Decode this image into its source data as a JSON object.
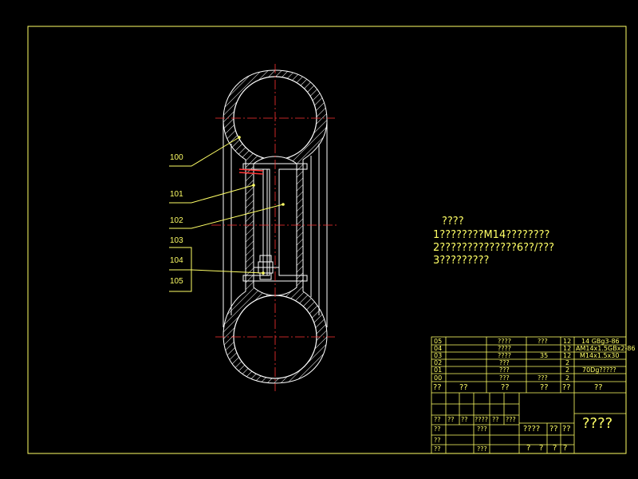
{
  "part_labels": [
    "100",
    "101",
    "102",
    "103",
    "104",
    "105"
  ],
  "notes": {
    "heading": "????",
    "line1": "1????????M14????????",
    "line2": "2??????????????6??/???",
    "line3": "3?????????"
  },
  "bom": {
    "rows": [
      {
        "no": "05",
        "name": "????",
        "qty_a": "???",
        "qty": "12",
        "spec": "14 GBg3-86"
      },
      {
        "no": "04",
        "name": "????",
        "qty_a": "",
        "qty": "12",
        "spec": "AM14x1.5GBx2-86"
      },
      {
        "no": "03",
        "name": "????",
        "qty_a": "35",
        "qty": "12",
        "spec": "M14x1.5x30"
      },
      {
        "no": "02",
        "name": "???",
        "qty_a": "",
        "qty": "2",
        "spec": ""
      },
      {
        "no": "01",
        "name": "???",
        "qty_a": "",
        "qty": "2",
        "spec": "70Dg?????"
      },
      {
        "no": "00",
        "name": "???",
        "qty_a": "???",
        "qty": "2",
        "spec": ""
      }
    ],
    "header": {
      "no": "??",
      "col1": "??",
      "name": "??",
      "qty_a": "??",
      "qty": "??",
      "spec": "??"
    }
  },
  "title_block": {
    "title": "????",
    "sign_row": [
      "??",
      "??",
      "??",
      "????",
      "??",
      "???"
    ],
    "left_rows": [
      "??",
      "??",
      "??"
    ],
    "mid_left": [
      "???",
      "???"
    ],
    "mid_row": [
      "????",
      "??",
      "??"
    ],
    "bottom_row": [
      "?",
      "?",
      "?",
      "?"
    ]
  }
}
